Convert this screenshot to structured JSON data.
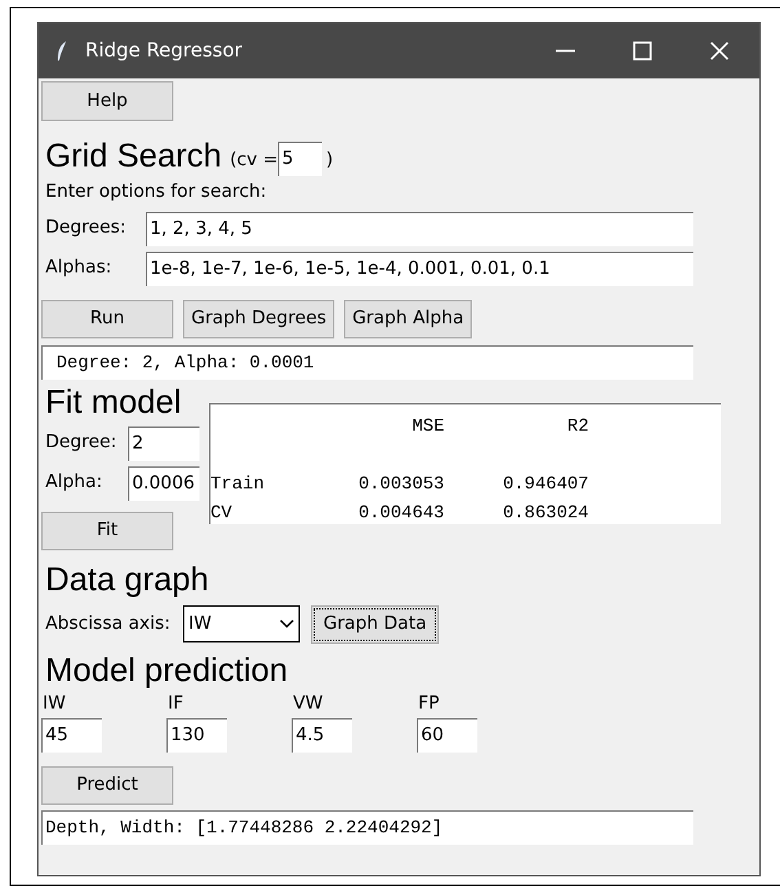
{
  "window": {
    "title": "Ridge Regressor"
  },
  "help_button": "Help",
  "grid_search": {
    "heading": "Grid Search",
    "cv_prefix": "(cv =",
    "cv_value": "5",
    "cv_suffix": ")",
    "instruction": "Enter options for search:",
    "fields": [
      {
        "label": "Degrees:",
        "value": "1, 2, 3, 4, 5"
      },
      {
        "label": "Alphas:",
        "value": "1e-8, 1e-7, 1e-6, 1e-5, 1e-4, 0.001, 0.01, 0.1"
      }
    ],
    "buttons": [
      "Run",
      "Graph Degrees",
      "Graph Alpha"
    ],
    "result": "Degree: 2, Alpha: 0.0001"
  },
  "fit_model": {
    "heading": "Fit model",
    "fields": [
      {
        "label": "Degree:",
        "value": "2"
      },
      {
        "label": "Alpha:",
        "value": "0.0006"
      }
    ],
    "button": "Fit",
    "table": {
      "columns": [
        "MSE",
        "R2"
      ],
      "rows": [
        {
          "label": "Train",
          "mse": "0.003053",
          "r2": "0.946407"
        },
        {
          "label": "CV",
          "mse": "0.004643",
          "r2": "0.863024"
        }
      ]
    }
  },
  "data_graph": {
    "heading": "Data graph",
    "axis_label": "Abscissa axis:",
    "axis_value": "IW",
    "button": "Graph Data"
  },
  "model_prediction": {
    "heading": "Model prediction",
    "inputs": [
      {
        "label": "IW",
        "value": "45"
      },
      {
        "label": "IF",
        "value": "130"
      },
      {
        "label": "VW",
        "value": "4.5"
      },
      {
        "label": "FP",
        "value": "60"
      }
    ],
    "button": "Predict",
    "result": "Depth, Width: [1.77448286 2.22404292]"
  }
}
